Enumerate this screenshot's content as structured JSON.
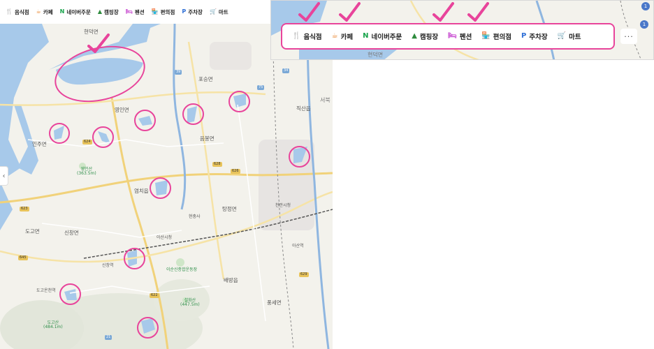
{
  "categories": [
    {
      "id": "restaurant",
      "label": "음식점",
      "icon": "fork-knife-icon",
      "glyph": "🍴",
      "color": "#e9862f"
    },
    {
      "id": "cafe",
      "label": "카페",
      "icon": "coffee-cup-icon",
      "glyph": "☕",
      "color": "#e9862f"
    },
    {
      "id": "naver-order",
      "label": "네이버주문",
      "icon": "naver-n-icon",
      "glyph": "N",
      "color": "#17a34a"
    },
    {
      "id": "camping",
      "label": "캠핑장",
      "icon": "tent-icon",
      "glyph": "▲",
      "color": "#2e8b3d"
    },
    {
      "id": "pension",
      "label": "펜션",
      "icon": "bed-icon",
      "glyph": "🛏",
      "color": "#c94fd1"
    },
    {
      "id": "convenience",
      "label": "편의점",
      "icon": "store-icon",
      "glyph": "🏪",
      "color": "#e5a321"
    },
    {
      "id": "parking",
      "label": "주차장",
      "icon": "parking-p-icon",
      "glyph": "P",
      "color": "#2f6fd6"
    },
    {
      "id": "mart",
      "label": "마트",
      "icon": "cart-icon",
      "glyph": "🛒",
      "color": "#e5a321"
    }
  ],
  "more_label": "···",
  "collapse_label": "‹",
  "map": {
    "labels": {
      "hyeondeok_top": "현덕면",
      "poseung": "포승면",
      "yeongin": "영인면",
      "injoo": "인주면",
      "yeongin_mt": "영인산",
      "yeongin_mt_h": "(363.5m)",
      "eumbong": "음봉면",
      "yeomchi": "염치읍",
      "tangjeong": "탕정면",
      "sinchang": "신창면",
      "dogo": "도고면",
      "baebang": "배방읍",
      "asan_station": "아산시청",
      "cheonan_station": "천안시청",
      "hyeonchung": "현충사",
      "sinchang_st": "신창역",
      "asan_sports": "이순신종합운동장",
      "seolhwa": "설화산",
      "seolhwa_h": "(447.5m)",
      "dogo_mt": "도고산",
      "dogo_h": "(484.1m)",
      "pungse": "풍세면",
      "seobuk": "서북",
      "jiksan": "직산읍",
      "dogo_oncheon": "도고온천역",
      "asan_yeok": "아산역"
    },
    "roads": [
      "624",
      "623",
      "628",
      "645",
      "626",
      "629",
      "622",
      "75",
      "39",
      "34",
      "21"
    ]
  },
  "zoom": {
    "bottom_label": "현덕면",
    "badge_1": "1",
    "badge_2": "1"
  }
}
